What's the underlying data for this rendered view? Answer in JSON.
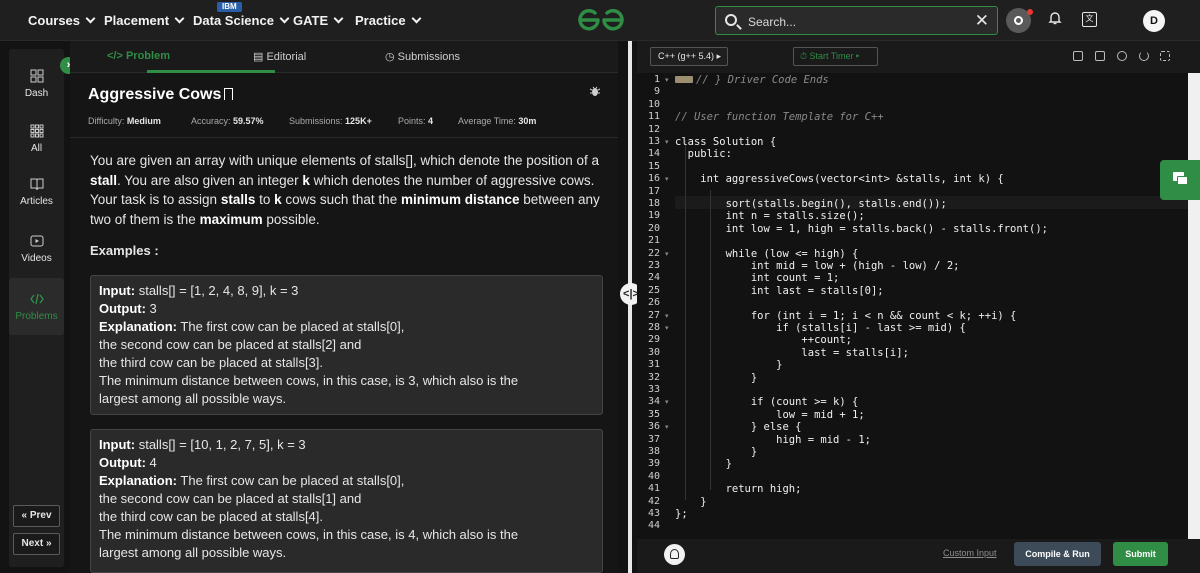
{
  "nav": {
    "items": [
      "Courses",
      "Placement",
      "Data Science",
      "GATE",
      "Practice"
    ],
    "badge": "IBM",
    "search_placeholder": "Search...",
    "avatar_initial": "D"
  },
  "sidebar": {
    "items": [
      "Dash",
      "All",
      "Articles",
      "Videos",
      "Problems"
    ],
    "prev_label": "« Prev",
    "next_label": "Next »"
  },
  "problem_tabs": [
    "Problem",
    "Editorial",
    "Submissions"
  ],
  "problem": {
    "title": "Aggressive Cows",
    "meta": [
      {
        "label": "Difficulty:",
        "value": "Medium"
      },
      {
        "label": "Accuracy:",
        "value": "59.57%"
      },
      {
        "label": "Submissions:",
        "value": "125K+"
      },
      {
        "label": "Points:",
        "value": "4"
      },
      {
        "label": "Average Time:",
        "value": "30m"
      }
    ],
    "desc": {
      "p1": "You are given an array with unique elements of stalls[], which denote the position of a ",
      "b1": "stall",
      "p2": ". You are also given an integer ",
      "b2": "k",
      "p3": " which denotes the number of aggressive cows. Your task is to assign ",
      "b3": "stalls",
      "p4": " to ",
      "b4": "k",
      "p5": " cows such that the ",
      "b5": "minimum distance",
      "p6": " between any two of them is the ",
      "b6": "maximum",
      "p7": " possible."
    },
    "examples_heading": "Examples :",
    "examples": [
      {
        "input_label": "Input:",
        "input": " stalls[] = [1, 2, 4, 8, 9], k = 3",
        "output_label": "Output:",
        "output": " 3",
        "expl_label": "Explanation:",
        "expl_lines": [
          " The first cow can be placed at stalls[0],",
          "the second cow can be placed at stalls[2] and",
          "the third cow can be placed at stalls[3].",
          "The minimum distance between cows, in this case, is 3, which also is the",
          "largest among all possible ways."
        ]
      },
      {
        "input_label": "Input:",
        "input": " stalls[] = [10, 1, 2, 7, 5], k = 3",
        "output_label": "Output:",
        "output": " 4",
        "expl_label": "Explanation:",
        "expl_lines": [
          " The first cow can be placed at stalls[0],",
          "the second cow can be placed at stalls[1] and",
          "the third cow can be placed at stalls[4].",
          "The minimum distance between cows, in this case, is 4, which also is the",
          "largest among all possible ways."
        ]
      }
    ]
  },
  "editor": {
    "language": "C++ (g++ 5.4)",
    "timer_label": "Start Timer",
    "line_numbers": [
      "1",
      "9",
      "10",
      "11",
      "12",
      "13",
      "14",
      "15",
      "16",
      "17",
      "18",
      "19",
      "20",
      "21",
      "22",
      "23",
      "24",
      "25",
      "26",
      "27",
      "28",
      "29",
      "30",
      "31",
      "32",
      "33",
      "34",
      "35",
      "36",
      "37",
      "38",
      "39",
      "40",
      "41",
      "42",
      "43",
      "44"
    ],
    "code_lines": [
      "// } Driver Code Ends",
      "",
      "",
      "// User function Template for C++",
      "",
      "class Solution {",
      "  public:",
      "",
      "    int aggressiveCows(vector<int> &stalls, int k) {",
      "",
      "        sort(stalls.begin(), stalls.end());",
      "        int n = stalls.size();",
      "        int low = 1, high = stalls.back() - stalls.front();",
      "",
      "        while (low <= high) {",
      "            int mid = low + (high - low) / 2;",
      "            int count = 1;",
      "            int last = stalls[0];",
      "",
      "            for (int i = 1; i < n && count < k; ++i) {",
      "                if (stalls[i] - last >= mid) {",
      "                    ++count;",
      "                    last = stalls[i];",
      "                }",
      "            }",
      "",
      "            if (count >= k) {",
      "                low = mid + 1;",
      "            } else {",
      "                high = mid - 1;",
      "            }",
      "        }",
      "",
      "        return high;",
      "    }",
      "};",
      ""
    ],
    "custom_input_label": "Custom Input",
    "run_label": "Compile & Run",
    "submit_label": "Submit"
  },
  "colors": {
    "brand_green": "#2f8d46",
    "run_button": "#3d4a57",
    "panel": "#2a2a2a"
  }
}
